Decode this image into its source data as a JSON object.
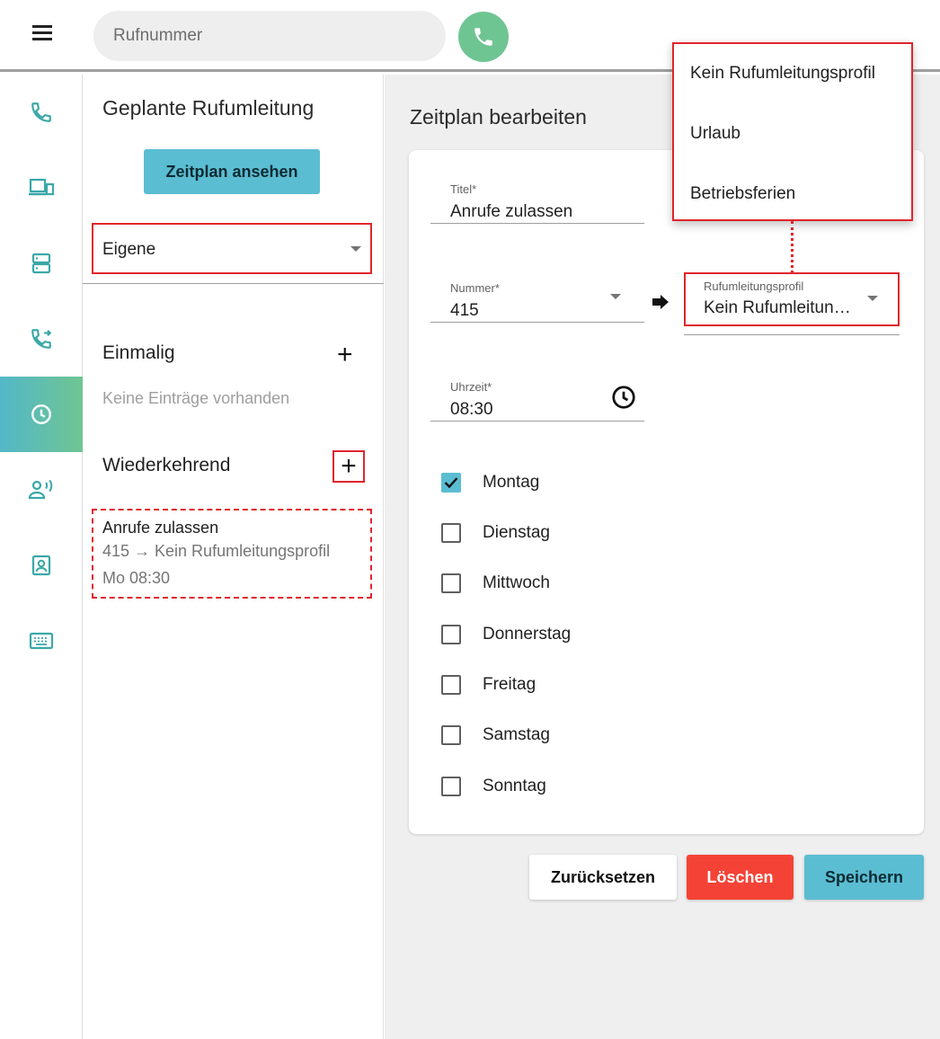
{
  "header": {
    "search_placeholder": "Rufnummer"
  },
  "rail": {
    "items": [
      "phone-icon",
      "devices-icon",
      "server-icon",
      "call-forward-icon",
      "clock-icon",
      "voicemail-icon",
      "contacts-icon",
      "keyboard-icon"
    ],
    "active": "clock-icon",
    "accent_colors": [
      "#53b7c8",
      "#6fc592"
    ]
  },
  "panel": {
    "title": "Geplante Rufumleitung",
    "view_button": "Zeitplan ansehen",
    "filter_value": "Eigene",
    "once_title": "Einmalig",
    "once_empty": "Keine Einträge vorhanden",
    "recurring_title": "Wiederkehrend",
    "entry": {
      "title": "Anrufe zulassen",
      "line2": "415 → Kein Rufumleitungsprofil",
      "line3": "Mo 08:30"
    }
  },
  "editor": {
    "title": "Zeitplan bearbeiten",
    "title_field": {
      "label": "Titel*",
      "value": "Anrufe zulassen"
    },
    "number_field": {
      "label": "Nummer*",
      "value": "415"
    },
    "profile_field": {
      "label": "Rufumleitungsprofil",
      "value": "Kein Rufumleitun…"
    },
    "time_field": {
      "label": "Uhrzeit*",
      "value": "08:30"
    },
    "days": [
      {
        "label": "Montag",
        "checked": true
      },
      {
        "label": "Dienstag",
        "checked": false
      },
      {
        "label": "Mittwoch",
        "checked": false
      },
      {
        "label": "Donnerstag",
        "checked": false
      },
      {
        "label": "Freitag",
        "checked": false
      },
      {
        "label": "Samstag",
        "checked": false
      },
      {
        "label": "Sonntag",
        "checked": false
      }
    ],
    "buttons": {
      "reset": "Zurücksetzen",
      "delete": "Löschen",
      "save": "Speichern"
    },
    "button_colors": {
      "reset": "#ffffff",
      "delete": "#f44336",
      "save": "#5bbdd2"
    }
  },
  "profile_menu": {
    "options": [
      "Kein Rufumleitungsprofil",
      "Urlaub",
      "Betriebsferien"
    ]
  }
}
